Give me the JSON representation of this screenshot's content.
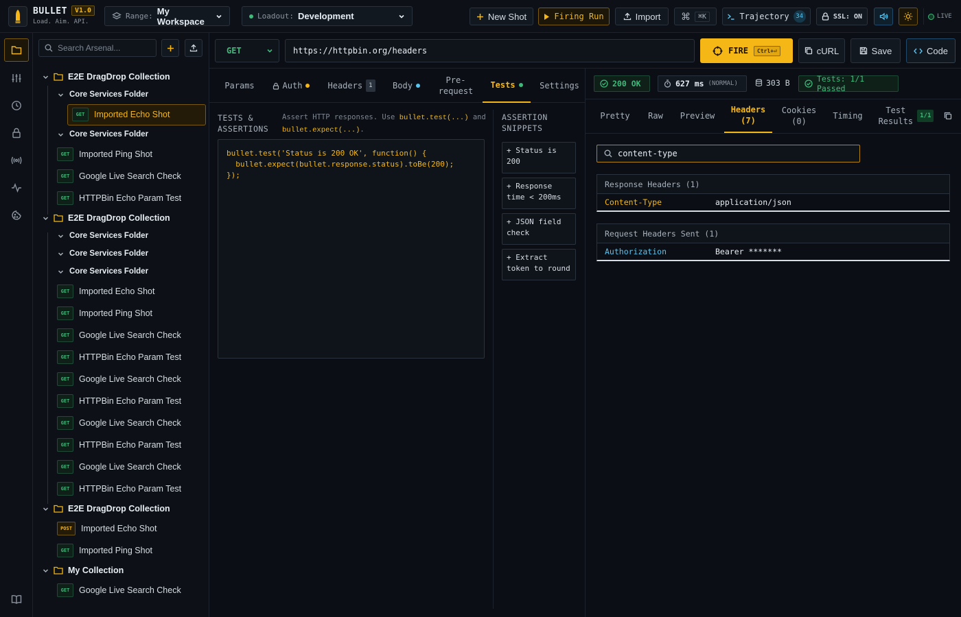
{
  "app": {
    "brand": "BULLET",
    "version": "V1.0",
    "tagline": "Load. Aim. API."
  },
  "topbar": {
    "range_label": "Range:",
    "range_value": "My Workspace",
    "loadout_label": "Loadout:",
    "loadout_value": "Development",
    "new_shot": "New Shot",
    "firing_run": "Firing Run",
    "import": "Import",
    "shortcut": "⌘K",
    "trajectory": "Trajectory",
    "trajectory_count": "34",
    "ssl": "SSL: ON",
    "live": "LIVE"
  },
  "colors": {
    "accent": "#f5b716",
    "get": "#3fb97a",
    "link": "#58c4f0",
    "bg": "#0b0f15"
  },
  "sidebar": {
    "search_placeholder": "Search Arsenal...",
    "tree": [
      {
        "type": "collection",
        "label": "E2E DragDrop Collection"
      },
      {
        "type": "folder",
        "label": "Core Services Folder"
      },
      {
        "type": "request",
        "method": "GET",
        "label": "Imported Echo Shot",
        "selected": true
      },
      {
        "type": "folder",
        "label": "Core Services Folder"
      },
      {
        "type": "request",
        "method": "GET",
        "label": "Imported Ping Shot"
      },
      {
        "type": "request",
        "method": "GET",
        "label": "Google Live Search Check"
      },
      {
        "type": "request",
        "method": "GET",
        "label": "HTTPBin Echo Param Test"
      },
      {
        "type": "collection",
        "label": "E2E DragDrop Collection"
      },
      {
        "type": "folder",
        "label": "Core Services Folder"
      },
      {
        "type": "folder",
        "label": "Core Services Folder"
      },
      {
        "type": "folder",
        "label": "Core Services Folder"
      },
      {
        "type": "request",
        "method": "GET",
        "label": "Imported Echo Shot"
      },
      {
        "type": "request",
        "method": "GET",
        "label": "Imported Ping Shot"
      },
      {
        "type": "request",
        "method": "GET",
        "label": "Google Live Search Check"
      },
      {
        "type": "request",
        "method": "GET",
        "label": "HTTPBin Echo Param Test"
      },
      {
        "type": "request",
        "method": "GET",
        "label": "Google Live Search Check"
      },
      {
        "type": "request",
        "method": "GET",
        "label": "HTTPBin Echo Param Test"
      },
      {
        "type": "request",
        "method": "GET",
        "label": "Google Live Search Check"
      },
      {
        "type": "request",
        "method": "GET",
        "label": "HTTPBin Echo Param Test"
      },
      {
        "type": "request",
        "method": "GET",
        "label": "Google Live Search Check"
      },
      {
        "type": "request",
        "method": "GET",
        "label": "HTTPBin Echo Param Test"
      },
      {
        "type": "collection",
        "label": "E2E DragDrop Collection"
      },
      {
        "type": "request",
        "method": "POST",
        "label": "Imported Echo Shot"
      },
      {
        "type": "request",
        "method": "GET",
        "label": "Imported Ping Shot"
      },
      {
        "type": "collection",
        "label": "My Collection"
      },
      {
        "type": "request",
        "method": "GET",
        "label": "Google Live Search Check"
      }
    ]
  },
  "request": {
    "method": "GET",
    "url": "https://httpbin.org/headers",
    "fire": "FIRE",
    "fire_shortcut": "Ctrl+⏎",
    "curl": "cURL",
    "save": "Save",
    "code": "Code",
    "tabs": {
      "params": "Params",
      "auth": "Auth",
      "headers": "Headers",
      "headers_count": "1",
      "body": "Body",
      "prerequest_1": "Pre-",
      "prerequest_2": "request",
      "tests": "Tests",
      "settings": "Settings"
    },
    "tests_title_1": "TESTS &",
    "tests_title_2": "ASSERTIONS",
    "hint_1": "Assert HTTP responses. Use ",
    "hint_code_1": "bullet.test(...)",
    "hint_2": " and ",
    "hint_code_2": "bullet.expect(...)",
    "hint_3": ".",
    "script": "bullet.test('Status is 200 OK', function() {\n  bullet.expect(bullet.response.status).toBe(200);\n});",
    "snippets_title_1": "ASSERTION",
    "snippets_title_2": "SNIPPETS",
    "snippets": [
      "+ Status is 200",
      "+ Response time < 200ms",
      "+ JSON field check",
      "+ Extract token to round"
    ]
  },
  "response": {
    "status": "200 OK",
    "time": "627 ms",
    "time_class": "(NORMAL)",
    "size": "303 B",
    "tests": "Tests: 1/1 Passed",
    "tabs": {
      "pretty": "Pretty",
      "raw": "Raw",
      "preview": "Preview",
      "headers_1": "Headers",
      "headers_2": "(7)",
      "cookies_1": "Cookies",
      "cookies_2": "(0)",
      "timing": "Timing",
      "test_results_1": "Test",
      "test_results_2": "Results",
      "test_results_badge": "1/1"
    },
    "filter_value": "content-type",
    "response_headers_title": "Response Headers (1)",
    "response_headers": [
      {
        "key": "Content-Type",
        "value": "application/json"
      }
    ],
    "request_headers_title": "Request Headers Sent (1)",
    "request_headers": [
      {
        "key": "Authorization",
        "value": "Bearer *******"
      }
    ]
  }
}
